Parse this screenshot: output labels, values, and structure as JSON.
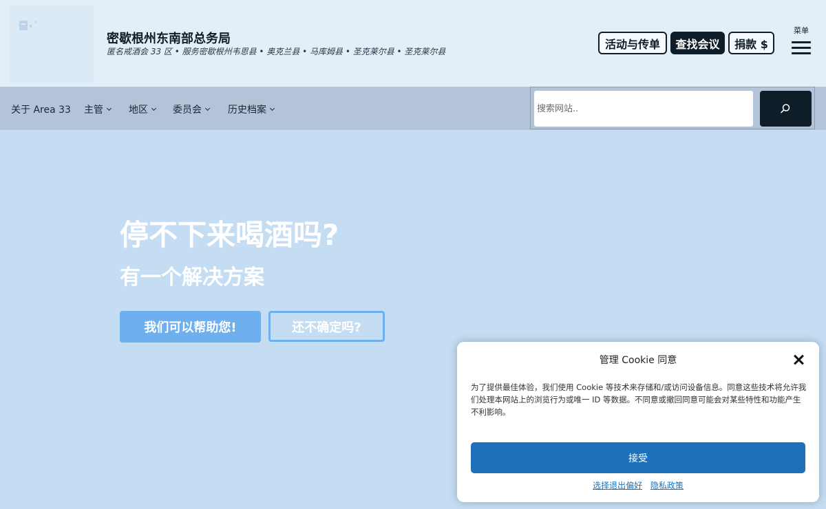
{
  "header": {
    "title": "密歇根州东南部总务局",
    "subtitle": "匿名戒酒会 33 区 • 服务密歇根州韦恩县 • 奥克兰县 • 马库姆县 • 圣克莱尔县 • 圣克莱尔县",
    "buttons": {
      "events": "活动与传单",
      "find": "查找会议",
      "donate": "捐款 $"
    },
    "menu_label": "菜单"
  },
  "nav": {
    "items": [
      {
        "label": "关于 Area 33",
        "dropdown": false
      },
      {
        "label": "主管",
        "dropdown": true
      },
      {
        "label": "地区",
        "dropdown": true
      },
      {
        "label": "委员会",
        "dropdown": true
      },
      {
        "label": "历史档案",
        "dropdown": true
      }
    ],
    "search_placeholder": "搜索网站.."
  },
  "hero": {
    "heading": "停不下来喝酒吗?",
    "subheading": "有一个解决方案",
    "primary_button": "我们可以帮助您!",
    "secondary_button": "还不确定吗?"
  },
  "cookie": {
    "title": "管理 Cookie 同意",
    "text": "为了提供最佳体验，我们使用 Cookie 等技术来存储和/或访问设备信息。同意这些技术将允许我们处理本网站上的浏览行为或唯一 ID 等数据。不同意或撤回同意可能会对某些特性和功能产生不利影响。",
    "accept": "接受",
    "preferences_link": "选择退出偏好",
    "privacy_link": "隐私政策"
  },
  "colors": {
    "page_bg": "#c5ddf2",
    "header_bg": "#e2eff9",
    "nav_bg": "#b3c4d8",
    "dark": "#0f1d28",
    "hero_button": "#6eb0ee",
    "accept_button": "#1e71b8"
  }
}
